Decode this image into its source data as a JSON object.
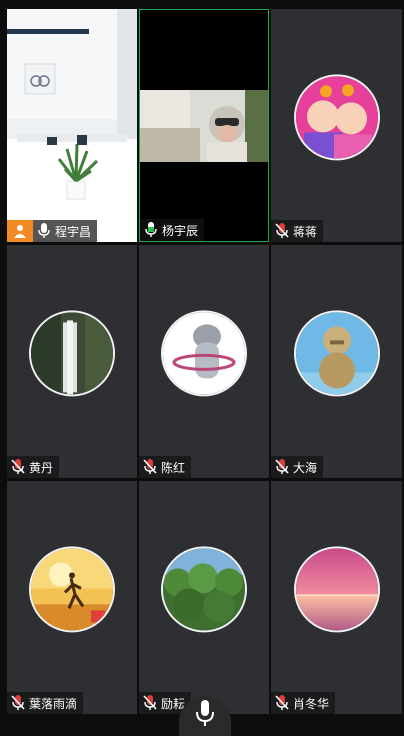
{
  "participants": [
    {
      "name": "程宇昌",
      "mic": "on",
      "host": true,
      "kind": "video-room"
    },
    {
      "name": "杨宇辰",
      "mic": "on",
      "host": false,
      "kind": "video-person",
      "active_speaker": true
    },
    {
      "name": "蒋蒋",
      "mic": "muted",
      "host": false,
      "kind": "avatar"
    },
    {
      "name": "黄丹",
      "mic": "muted",
      "host": false,
      "kind": "avatar"
    },
    {
      "name": "陈红",
      "mic": "muted",
      "host": false,
      "kind": "avatar"
    },
    {
      "name": "大海",
      "mic": "muted",
      "host": false,
      "kind": "avatar"
    },
    {
      "name": "葉落雨滴",
      "mic": "muted",
      "host": false,
      "kind": "avatar"
    },
    {
      "name": "励耘",
      "mic": "muted",
      "host": false,
      "kind": "avatar"
    },
    {
      "name": "肖冬华",
      "mic": "muted",
      "host": false,
      "kind": "avatar"
    }
  ],
  "colors": {
    "active_border": "#1fa84f",
    "host_badge": "#f28b24",
    "mic_muted": "#e03b3b",
    "mic_on": "#ffffff",
    "mic_active": "#2fbf4f"
  },
  "icons": {
    "mic_on": "microphone-icon",
    "mic_muted": "microphone-muted-icon",
    "host": "person-icon",
    "bottom": "microphone-icon"
  }
}
